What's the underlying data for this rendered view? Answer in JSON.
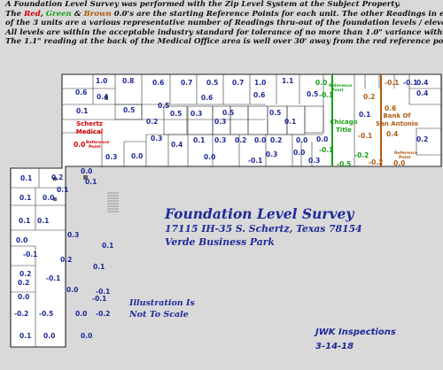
{
  "header": {
    "line1": "A Foundation Level Survey was performed with the Zip Level System at the Subject Property.",
    "line2_pre": "The ",
    "red_word": "Red",
    "comma1": ", ",
    "green_word": "Green",
    "amp": " & ",
    "brown_word": "Brown",
    "line2_post": " 0.0's are the starting Reference Points for each unit. The other Readings in each",
    "line3": "of the 3 units are a various representative number of Readings thru-out of the foundation levels / elevations.",
    "line4": "All levels are within the acceptable industry standard for tolerance of no more than 1.0\" variance within 30'.",
    "line5": "The 1.1\" reading at the back of the Medical Office area is well over 30' away from the red reference point."
  },
  "units": {
    "medical": "Schertz Medical",
    "title": "Chicago Title",
    "bank": "Bank Of San Antonio"
  },
  "reference_point_label": "Reference Point",
  "title_block": {
    "main": "Foundation Level Survey",
    "address": "17115 IH-35 S. Schertz, Texas 78154",
    "park": "Verde Business Park"
  },
  "scale_note": "Illustration Is Not To Scale",
  "credit": {
    "company": "JWK Inspections",
    "date": "3-14-18"
  },
  "colors": {
    "red_reference": "#d40000",
    "green_reference": "#16a016",
    "brown_reference": "#b05a10",
    "readings": "#1f2a9a"
  },
  "readings": {
    "red_ref": "0.0",
    "green_ref": "0.0",
    "brown_ref": "0.0",
    "blue": [
      "1.0",
      "0.8",
      "0.7",
      "0.7",
      "1.0",
      "1.1",
      "0.6",
      "0.6",
      "0.5",
      "0.4",
      "0.5",
      "0.5",
      "0.6",
      "0.5",
      "0.5",
      "0.1",
      "0.5",
      "0.5",
      "0.6",
      "0.3",
      "0.2",
      "0.3",
      "0.3",
      "0.4",
      "0.1",
      "0.3",
      "0.2",
      "0.1",
      "0.0",
      "0.2",
      "0.0",
      "0.0",
      "0.3",
      "0.0",
      "0.3",
      "0.0",
      "0.0",
      "0.1",
      "0.1",
      "-0.1",
      "0.0",
      "0.2",
      "0.1",
      "0.1",
      "0.0",
      "0.1",
      "0.2",
      "0.0",
      "0.1",
      "0.3",
      "0.0",
      "0.2",
      "-0.1",
      "0.1",
      "0.2",
      "-0.1",
      "0.1",
      "0.0",
      "0.1",
      "0.0",
      "0.0",
      "-0.1",
      "0.0",
      "-0.2",
      "-0.5",
      "-0.2",
      "-0.1",
      "0.3"
    ],
    "green": [
      "-0.1",
      "-0.1",
      "-0.5",
      "-0.2"
    ],
    "brown": [
      "-0.1",
      "0.6",
      "0.4",
      "-0.1",
      "-0.2",
      "0.2"
    ],
    "unit3_blue": [
      "0.4",
      "0.4",
      "0.2",
      "-0.1",
      "0.1"
    ]
  }
}
